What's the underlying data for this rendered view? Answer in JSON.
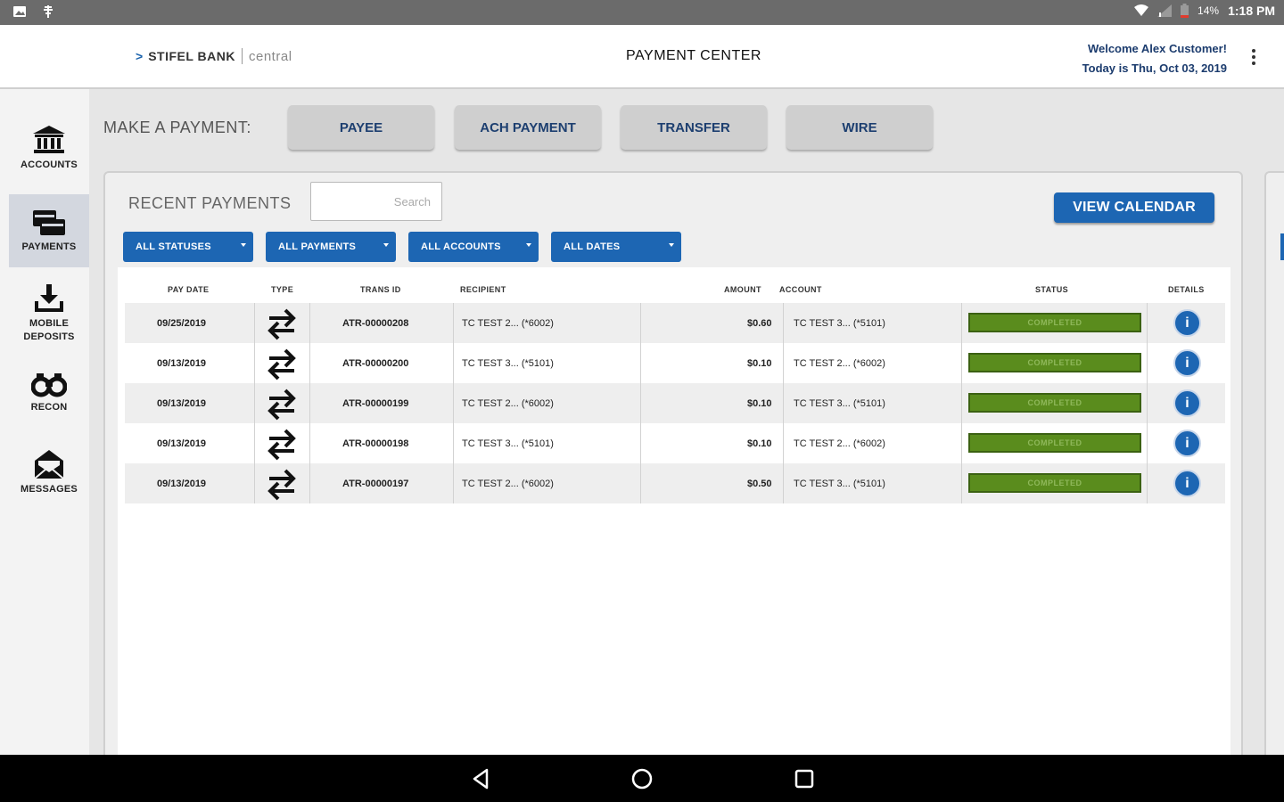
{
  "status_bar": {
    "battery": "14%",
    "time": "1:18 PM"
  },
  "header": {
    "brand_chevron": ">",
    "brand_bank": "STIFEL BANK",
    "brand_product": "central",
    "title": "PAYMENT CENTER",
    "welcome": "Welcome Alex Customer!",
    "date_line": "Today is Thu, Oct 03, 2019"
  },
  "sidebar": {
    "items": [
      {
        "label": "ACCOUNTS",
        "icon": "bank-icon"
      },
      {
        "label": "PAYMENTS",
        "icon": "payments-icon"
      },
      {
        "label_line1": "MOBILE",
        "label_line2": "DEPOSITS",
        "icon": "deposit-icon"
      },
      {
        "label": "RECON",
        "icon": "binoculars-icon"
      },
      {
        "label": "MESSAGES",
        "icon": "envelope-icon"
      }
    ],
    "active": "PAYMENTS"
  },
  "make_payment": {
    "label": "MAKE A PAYMENT:",
    "buttons": [
      "PAYEE",
      "ACH PAYMENT",
      "TRANSFER",
      "WIRE"
    ]
  },
  "recent": {
    "title": "RECENT PAYMENTS",
    "search_placeholder": "Search",
    "calendar_button": "VIEW CALENDAR",
    "filters": [
      "ALL STATUSES",
      "ALL PAYMENTS",
      "ALL ACCOUNTS",
      "ALL DATES"
    ]
  },
  "table": {
    "headers": {
      "pay_date": "PAY DATE",
      "type": "TYPE",
      "trans_id": "TRANS ID",
      "recipient": "RECIPIENT",
      "amount": "AMOUNT",
      "account": "ACCOUNT",
      "status": "STATUS",
      "details": "DETAILS"
    },
    "rows": [
      {
        "pay_date": "09/25/2019",
        "type_icon": "transfer-icon",
        "trans_id": "ATR-00000208",
        "recipient": "TC TEST 2... (*6002)",
        "amount": "$0.60",
        "account": "TC TEST 3... (*5101)",
        "status": "COMPLETED",
        "details": "i"
      },
      {
        "pay_date": "09/13/2019",
        "type_icon": "transfer-icon",
        "trans_id": "ATR-00000200",
        "recipient": "TC TEST 3... (*5101)",
        "amount": "$0.10",
        "account": "TC TEST 2... (*6002)",
        "status": "COMPLETED",
        "details": "i"
      },
      {
        "pay_date": "09/13/2019",
        "type_icon": "transfer-icon",
        "trans_id": "ATR-00000199",
        "recipient": "TC TEST 2... (*6002)",
        "amount": "$0.10",
        "account": "TC TEST 3... (*5101)",
        "status": "COMPLETED",
        "details": "i"
      },
      {
        "pay_date": "09/13/2019",
        "type_icon": "transfer-icon",
        "trans_id": "ATR-00000198",
        "recipient": "TC TEST 3... (*5101)",
        "amount": "$0.10",
        "account": "TC TEST 2... (*6002)",
        "status": "COMPLETED",
        "details": "i"
      },
      {
        "pay_date": "09/13/2019",
        "type_icon": "transfer-icon",
        "trans_id": "ATR-00000197",
        "recipient": "TC TEST 2... (*6002)",
        "amount": "$0.50",
        "account": "TC TEST 3... (*5101)",
        "status": "COMPLETED",
        "details": "i"
      }
    ]
  },
  "colors": {
    "accent_blue": "#1d66b3",
    "status_green": "#5a8c1d",
    "header_text": "#1c3c6e"
  }
}
